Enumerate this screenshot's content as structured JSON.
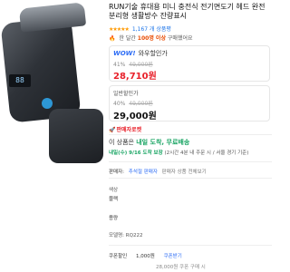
{
  "product": {
    "title": "RUN기술 휴대용 미니 충전식 전기면도기 헤드 완전분리형 생활방수 잔량표시",
    "rating_stars": "★★★★★",
    "review_count": "1,167 개 상품평",
    "purchased_prefix": "한 달간",
    "purchased_count": "100명 이상",
    "purchased_suffix": "구매했어요",
    "display_digits": "88"
  },
  "price_box_wow": {
    "label_brand": "WOW!",
    "label_text": "와우할인가",
    "discount_pct": "41%",
    "original_price": "49,000원",
    "price": "28,710원"
  },
  "price_box_normal": {
    "label": "일반할인가",
    "discount_pct": "40%",
    "original_price": "49,000원",
    "price": "29,000원"
  },
  "rocket": {
    "label": "판매자로켓"
  },
  "delivery": {
    "line1_prefix": "이 상품은",
    "line1_highlight": "내일 도착, 무료배송",
    "line2_highlight": "내일(수) 9/16 도착 보장",
    "line2_rest": "(2시간 4분 내 주문 시 / 서울 경기 기준)"
  },
  "seller": {
    "label": "판매자:",
    "name": "추석절 판매자",
    "view_link": "판매자 상품 전체보기"
  },
  "options": [
    {
      "label": "색상",
      "value": "블랙"
    },
    {
      "label": "",
      "value": "용량"
    },
    {
      "label": "모델명:",
      "value": "RQ222"
    }
  ],
  "coupon": {
    "label": "쿠폰할인",
    "amount": "1,000원",
    "download": "쿠폰받기",
    "after_price": "28,000원 쿠폰 구매 시"
  }
}
